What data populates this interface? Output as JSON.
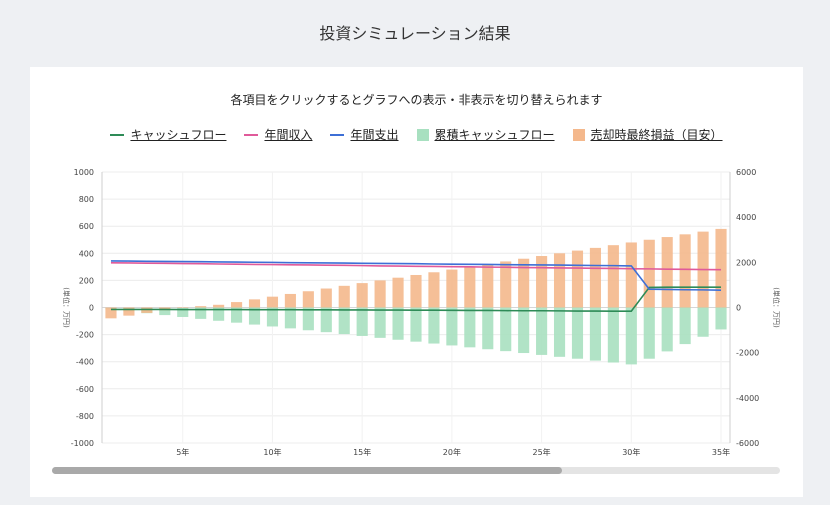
{
  "page_title": "投資シミュレーション結果",
  "subtitle": "各項目をクリックするとグラフへの表示・非表示を切り替えられます",
  "legend": [
    {
      "label": "キャッシュフロー",
      "kind": "line",
      "color": "#2e8b57"
    },
    {
      "label": "年間収入",
      "kind": "line",
      "color": "#e05a9a"
    },
    {
      "label": "年間支出",
      "kind": "line",
      "color": "#3d6fd6"
    },
    {
      "label": "累積キャッシュフロー",
      "kind": "box",
      "color": "#a8e0c0"
    },
    {
      "label": "売却時最終損益（目安）",
      "kind": "box",
      "color": "#f4b88c"
    }
  ],
  "chart_data": {
    "type": "bar",
    "x": [
      1,
      2,
      3,
      4,
      5,
      6,
      7,
      8,
      9,
      10,
      11,
      12,
      13,
      14,
      15,
      16,
      17,
      18,
      19,
      20,
      21,
      22,
      23,
      24,
      25,
      26,
      27,
      28,
      29,
      30,
      31,
      32,
      33,
      34,
      35
    ],
    "x_tick_labels": [
      "5年",
      "10年",
      "15年",
      "20年",
      "25年",
      "30年",
      "35年"
    ],
    "x_tick_values": [
      5,
      10,
      15,
      20,
      25,
      30,
      35
    ],
    "y_left": {
      "ticks": [
        1000,
        800,
        600,
        400,
        200,
        0,
        -200,
        -400,
        -600,
        -800,
        -1000
      ],
      "range": [
        -1000,
        1000
      ],
      "label": "(単位：万円)"
    },
    "y_right": {
      "ticks": [
        6000,
        4000,
        2000,
        0,
        -2000,
        -4000,
        -6000
      ],
      "range": [
        -6000,
        6000
      ],
      "label": "(単位：万円)"
    },
    "series": [
      {
        "name": "キャッシュフロー",
        "type": "line",
        "axis": "left",
        "color": "#2e8b57",
        "values": [
          -14,
          -14,
          -14,
          -14,
          -15,
          -15,
          -15,
          -15,
          -16,
          -16,
          -16,
          -17,
          -17,
          -18,
          -18,
          -19,
          -19,
          -20,
          -20,
          -21,
          -22,
          -22,
          -23,
          -24,
          -24,
          -25,
          -26,
          -26,
          -27,
          -27,
          148,
          150,
          150,
          150,
          150
        ]
      },
      {
        "name": "年間収入",
        "type": "line",
        "axis": "left",
        "color": "#e05a9a",
        "values": [
          330,
          329,
          327,
          326,
          324,
          323,
          321,
          320,
          318,
          317,
          315,
          314,
          312,
          311,
          309,
          307,
          306,
          304,
          303,
          301,
          300,
          298,
          297,
          295,
          294,
          292,
          291,
          289,
          288,
          286,
          285,
          283,
          282,
          280,
          279
        ]
      },
      {
        "name": "年間支出",
        "type": "line",
        "axis": "left",
        "color": "#3d6fd6",
        "values": [
          344,
          343,
          341,
          340,
          339,
          338,
          336,
          335,
          334,
          333,
          331,
          330,
          329,
          328,
          326,
          325,
          324,
          323,
          321,
          320,
          319,
          318,
          316,
          315,
          314,
          313,
          311,
          310,
          309,
          307,
          135,
          133,
          131,
          130,
          128
        ]
      },
      {
        "name": "累積キャッシュフロー",
        "type": "bar",
        "axis": "right",
        "color": "#a8e0c0",
        "values": [
          -84,
          -168,
          -252,
          -336,
          -420,
          -504,
          -588,
          -672,
          -756,
          -840,
          -924,
          -1008,
          -1092,
          -1176,
          -1260,
          -1344,
          -1428,
          -1512,
          -1596,
          -1680,
          -1764,
          -1848,
          -1932,
          -2016,
          -2100,
          -2184,
          -2268,
          -2352,
          -2436,
          -2520,
          -2268,
          -1944,
          -1620,
          -1296,
          -972
        ]
      },
      {
        "name": "売却時最終損益（目安）",
        "type": "bar",
        "axis": "right",
        "color": "#f4b88c",
        "values": [
          -480,
          -360,
          -240,
          -120,
          0,
          60,
          120,
          240,
          360,
          480,
          600,
          720,
          840,
          960,
          1080,
          1200,
          1320,
          1440,
          1560,
          1680,
          1800,
          1920,
          2040,
          2160,
          2280,
          2400,
          2520,
          2640,
          2760,
          2880,
          3000,
          3120,
          3240,
          3360,
          3480
        ]
      }
    ]
  }
}
